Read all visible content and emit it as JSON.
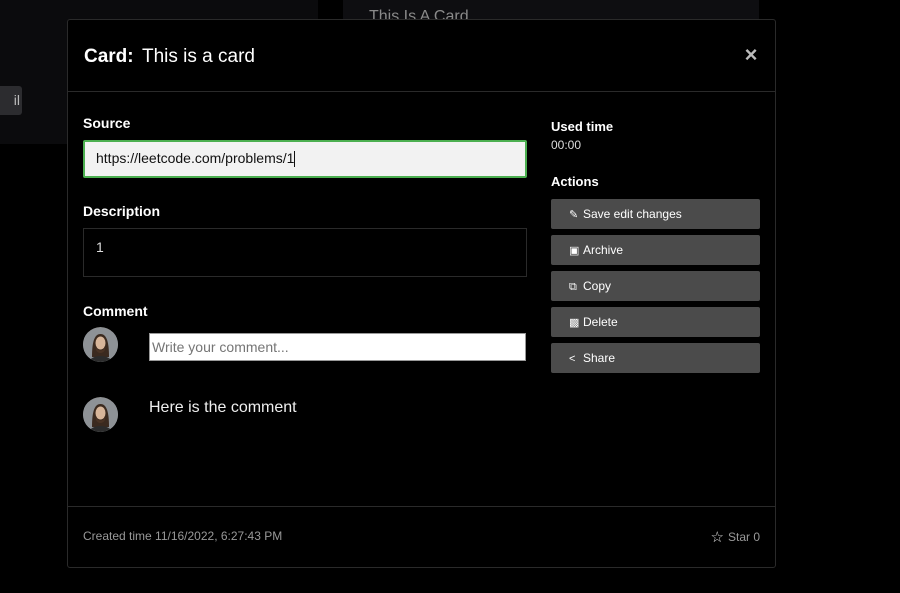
{
  "background": {
    "card_title": "This Is A Card",
    "button_fragment": "il"
  },
  "modal": {
    "title_label": "Card:",
    "title_value": "This is a card",
    "close_icon": "×",
    "source": {
      "label": "Source",
      "value": "https://leetcode.com/problems/1"
    },
    "description": {
      "label": "Description",
      "value": "1"
    },
    "comment": {
      "label": "Comment",
      "placeholder": "Write your comment...",
      "items": [
        {
          "text": "Here is the comment"
        }
      ]
    },
    "used_time": {
      "label": "Used time",
      "value": "00:00"
    },
    "actions": {
      "label": "Actions",
      "buttons": [
        {
          "label": "Save edit changes",
          "icon": "pencil-icon"
        },
        {
          "label": "Archive",
          "icon": "archive-icon"
        },
        {
          "label": "Copy",
          "icon": "copy-icon"
        },
        {
          "label": "Delete",
          "icon": "trash-icon"
        },
        {
          "label": "Share",
          "icon": "share-icon"
        }
      ]
    },
    "footer": {
      "created": "Created time 11/16/2022, 6:27:43 PM",
      "star_label": "Star 0"
    }
  },
  "colors": {
    "background": "#000000",
    "button": "#4b4b4b",
    "focus_border": "#4caf50"
  }
}
